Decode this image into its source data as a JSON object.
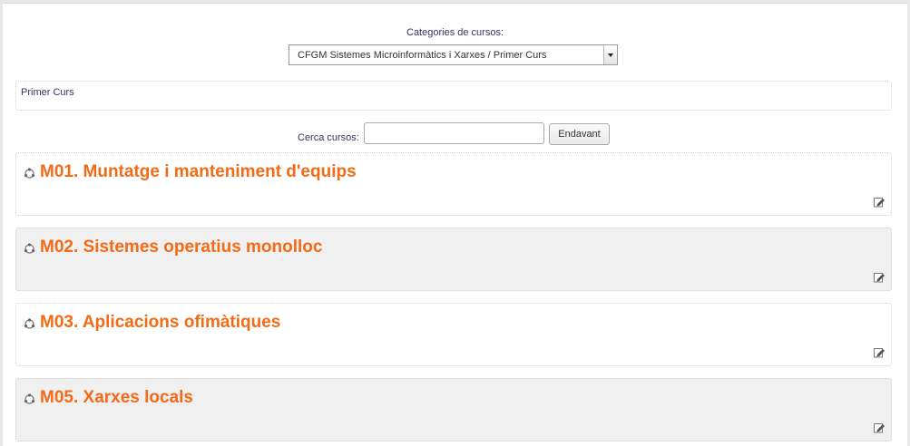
{
  "categories": {
    "label": "Categories de cursos:",
    "selected": "CFGM Sistemes Microinformàtics i Xarxes / Primer Curs"
  },
  "category_description": "Primer Curs",
  "search": {
    "label": "Cerca cursos:",
    "value": "",
    "button_label": "Endavant"
  },
  "courses": [
    {
      "title": "M01. Muntatge i manteniment d'equips"
    },
    {
      "title": "M02. Sistemes operatius monolloc"
    },
    {
      "title": "M03. Aplicacions ofimàtiques"
    },
    {
      "title": "M05. Xarxes locals"
    }
  ],
  "icons": {
    "course": "course-icon",
    "enrolment": "self-enrolment-icon",
    "select_arrow": "chevron-down-icon"
  },
  "colors": {
    "course_title": "#f36b16",
    "label_text": "#333366",
    "alt_row_bg": "#f0f0f0"
  }
}
